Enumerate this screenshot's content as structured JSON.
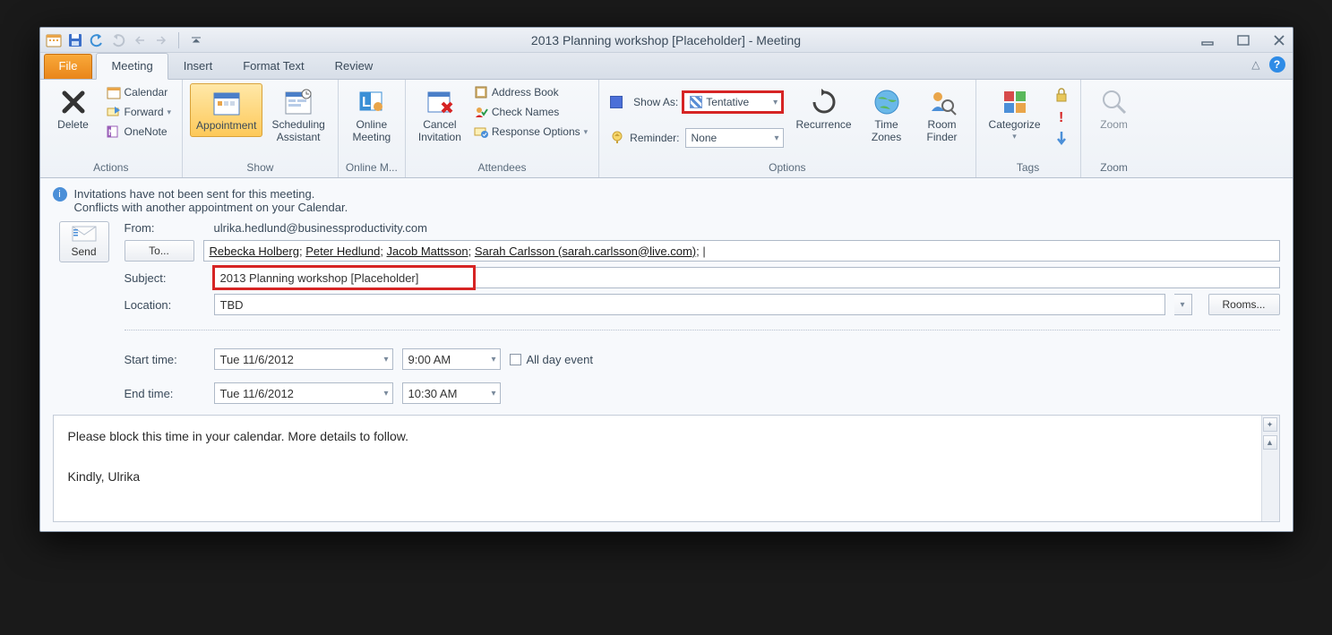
{
  "titlebar": {
    "title": "2013 Planning workshop [Placeholder]  -  Meeting"
  },
  "tabs": {
    "file": "File",
    "meeting": "Meeting",
    "insert": "Insert",
    "format_text": "Format Text",
    "review": "Review"
  },
  "ribbon": {
    "actions": {
      "label": "Actions",
      "delete": "Delete",
      "calendar": "Calendar",
      "forward": "Forward",
      "onenote": "OneNote"
    },
    "show": {
      "label": "Show",
      "appointment": "Appointment",
      "scheduling": "Scheduling\nAssistant"
    },
    "online": {
      "label": "Online M...",
      "online_meeting": "Online\nMeeting"
    },
    "attendees": {
      "label": "Attendees",
      "cancel": "Cancel\nInvitation",
      "address_book": "Address Book",
      "check_names": "Check Names",
      "response_options": "Response Options"
    },
    "options": {
      "label": "Options",
      "show_as_label": "Show As:",
      "show_as_value": "Tentative",
      "reminder_label": "Reminder:",
      "reminder_value": "None",
      "recurrence": "Recurrence",
      "time_zones": "Time\nZones",
      "room_finder": "Room\nFinder"
    },
    "tags": {
      "label": "Tags",
      "categorize": "Categorize"
    },
    "zoom": {
      "label": "Zoom",
      "zoom": "Zoom"
    }
  },
  "info": {
    "line1": "Invitations have not been sent for this meeting.",
    "line2": "Conflicts with another appointment on your Calendar."
  },
  "form": {
    "send": "Send",
    "from_label": "From:",
    "from_value": "ulrika.hedlund@businessproductivity.com",
    "to_label": "To...",
    "to_r1": "Rebecka Holberg",
    "to_r2": "Peter Hedlund",
    "to_r3": "Jacob Mattsson",
    "to_r4": "Sarah Carlsson (sarah.carlsson@live.com)",
    "subject_label": "Subject:",
    "subject_value": "2013 Planning workshop [Placeholder]",
    "location_label": "Location:",
    "location_value": "TBD",
    "rooms": "Rooms...",
    "start_label": "Start time:",
    "start_date": "Tue 11/6/2012",
    "start_time": "9:00 AM",
    "end_label": "End time:",
    "end_date": "Tue 11/6/2012",
    "end_time": "10:30 AM",
    "all_day": "All day event"
  },
  "body": {
    "line1": "Please block this time in your calendar. More details to follow.",
    "line2": "Kindly, Ulrika"
  }
}
